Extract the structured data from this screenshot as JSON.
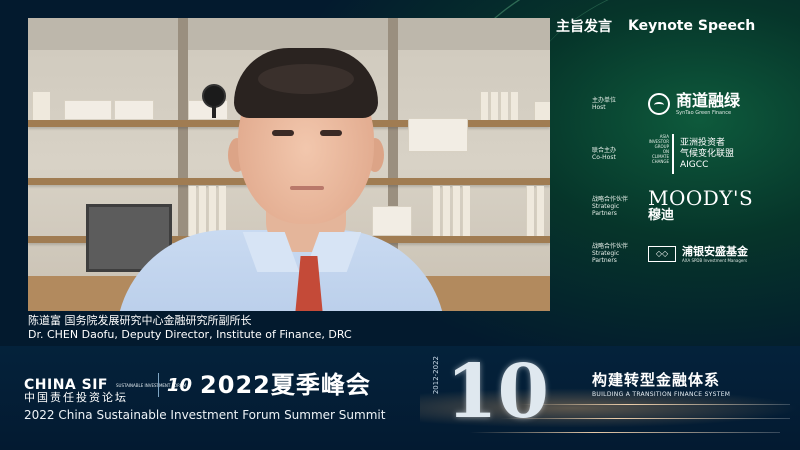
{
  "session": {
    "label_cn": "主旨发言",
    "label_en": "Keynote Speech"
  },
  "speaker": {
    "caption_cn": "陈道富  国务院发展研究中心金融研究所副所长",
    "caption_en": "Dr. CHEN Daofu, Deputy Director, Institute of Finance, DRC"
  },
  "sponsors": [
    {
      "role_cn": "主办单位",
      "role_en": "Host",
      "name_cn": "商道融绿",
      "name_en": "SynTao Green Finance",
      "icon": "syntao-logo-icon"
    },
    {
      "role_cn": "联合主办",
      "role_en": "Co-Host",
      "name_cn_line1": "亚洲投资者",
      "name_cn_line2": "气候变化联盟",
      "name_en": "AIGCC",
      "vertical_text": "ASIA INVESTOR GROUP ON CLIMATE CHANGE",
      "icon": "aigcc-logo-icon"
    },
    {
      "role_cn": "战略合作伙伴",
      "role_en": "Strategic Partners",
      "name_en": "MOODY'S",
      "name_cn": "穆迪",
      "icon": "moodys-logo-icon"
    },
    {
      "role_cn": "战略合作伙伴",
      "role_en": "Strategic Partners",
      "name_cn": "浦银安盛基金",
      "name_en": "AXA SPDB Investment Managers",
      "icon": "axa-spdb-logo-icon"
    }
  ],
  "banner": {
    "brand": "CHINA SIF",
    "brand_sub": "SUSTAINABLE INVESTMENT FORUM",
    "ten_badge": "10",
    "summit_cn": "2022夏季峰会",
    "brand_cn": "中国责任投资论坛",
    "summit_en": "2022 China Sustainable Investment Forum Summer Summit",
    "big_number": "10",
    "years": "2012-2022",
    "theme_cn": "构建转型金融体系",
    "theme_en": "BUILDING A TRANSITION FINANCE SYSTEM"
  },
  "colors": {
    "banner_bg": "#04223b",
    "panel_green": "#06352a",
    "tie": "#c44a38"
  }
}
